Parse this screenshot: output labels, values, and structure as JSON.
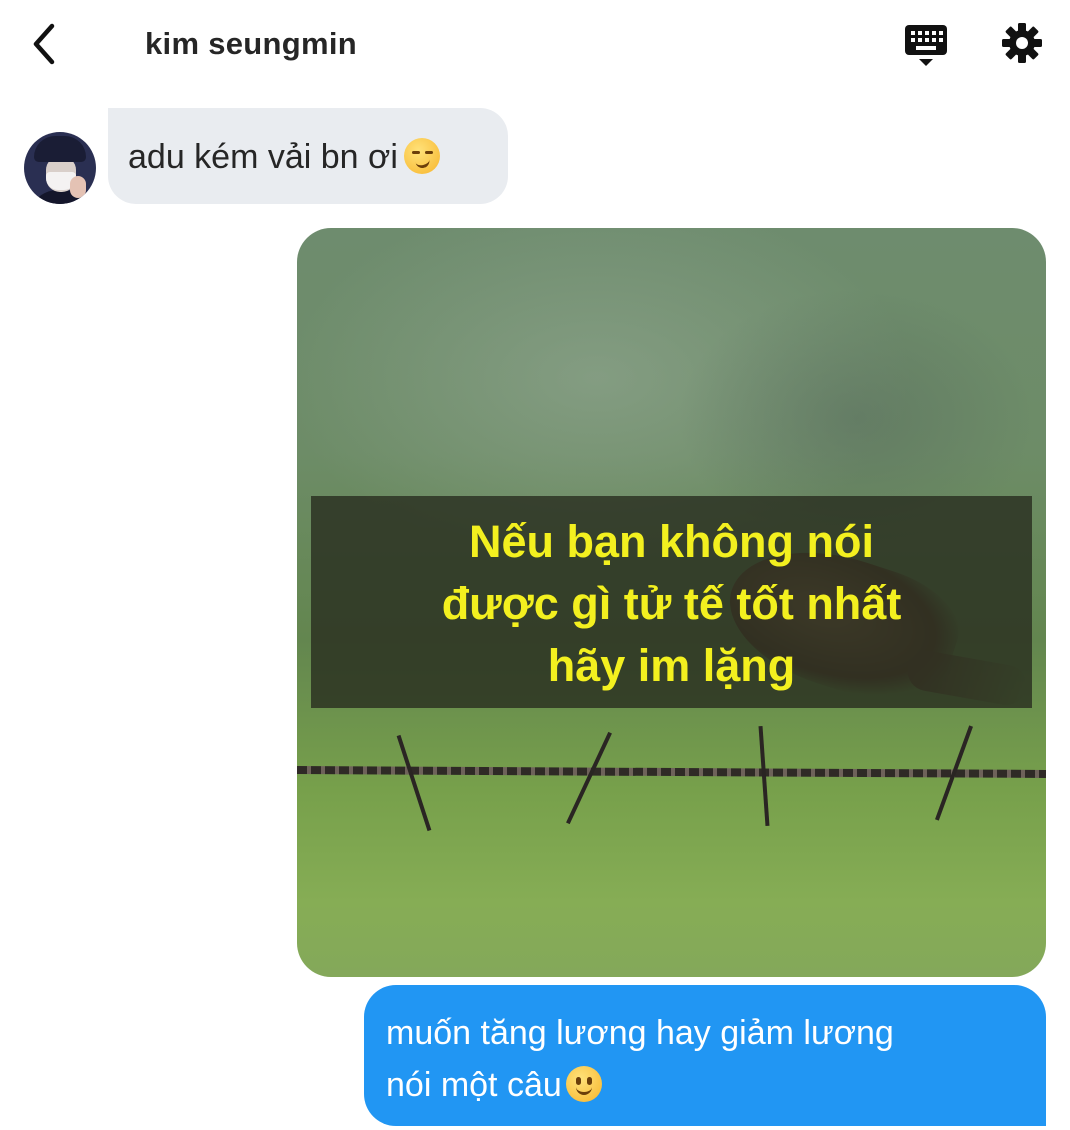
{
  "header": {
    "title": "kim seungmin",
    "back_icon": "chevron-left-icon",
    "keyboard_icon": "keyboard-icon",
    "settings_icon": "gear-icon"
  },
  "messages": [
    {
      "direction": "incoming",
      "type": "text",
      "text": "adu kém vải bn ơi",
      "emoji": "smirking-face-emoji"
    },
    {
      "direction": "outgoing",
      "type": "image",
      "caption_lines": [
        "Nếu bạn không nói",
        "được gì tử tế tốt nhất",
        "hãy im lặng"
      ]
    },
    {
      "direction": "outgoing",
      "type": "text",
      "lines": [
        "muốn tăng lương hay giảm lương",
        "nói một câu"
      ],
      "emoji": "slightly-smiling-face-emoji"
    }
  ],
  "colors": {
    "incoming_bubble": "#e9ecf0",
    "outgoing_bubble": "#2196f3",
    "caption_text": "#f3f01f"
  }
}
